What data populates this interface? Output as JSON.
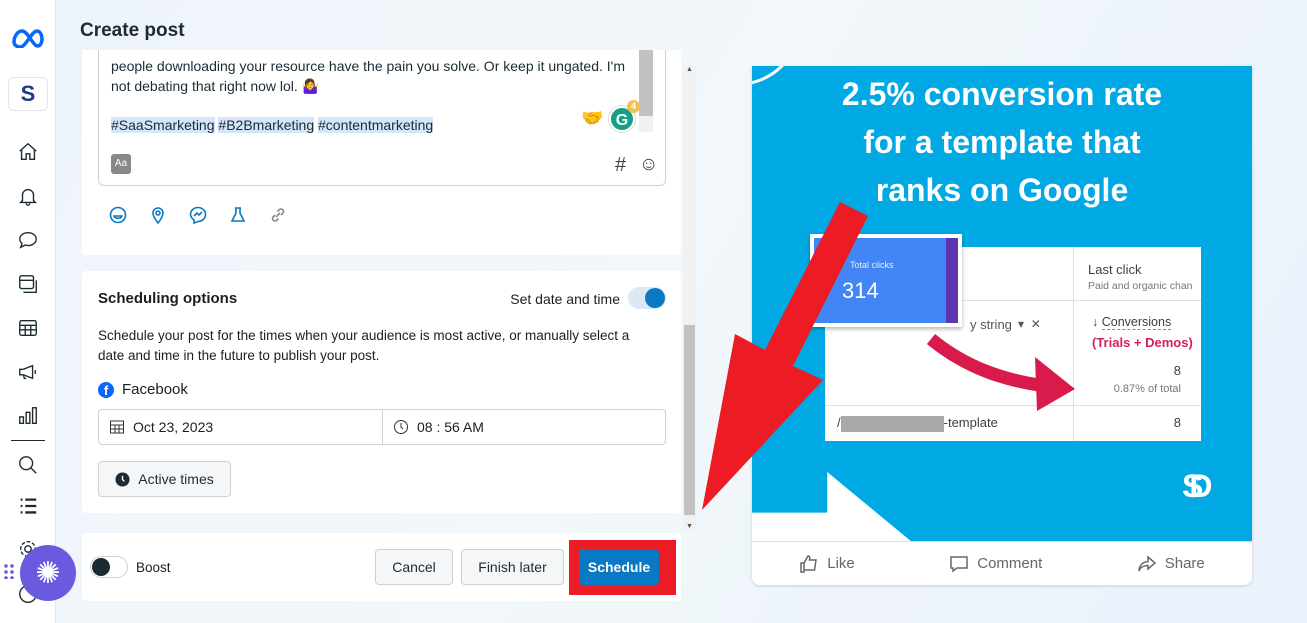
{
  "header": {
    "title": "Create post"
  },
  "sidebar": {
    "items": [
      {
        "name": "home",
        "icon": "home-icon"
      },
      {
        "name": "notifications",
        "icon": "bell-icon"
      },
      {
        "name": "inbox",
        "icon": "chat-icon"
      },
      {
        "name": "content",
        "icon": "content-icon"
      },
      {
        "name": "planner",
        "icon": "calendar-icon"
      },
      {
        "name": "ads",
        "icon": "megaphone-icon"
      },
      {
        "name": "insights",
        "icon": "bar-chart-icon"
      },
      {
        "name": "search",
        "icon": "search-icon"
      },
      {
        "name": "all-tools",
        "icon": "list-icon"
      },
      {
        "name": "settings",
        "icon": "gear-icon"
      },
      {
        "name": "help",
        "icon": "help-icon"
      }
    ],
    "account_initial": "S"
  },
  "editor": {
    "line1": "people downloading your resource have the pain you solve. Or keep it ungated. I'm",
    "line2": "not debating that right now lol. 🤷‍♀️",
    "hashtags": [
      "#SaaSmarketing",
      "#B2Bmarketing",
      "#contentmarketing"
    ],
    "grammarly_count": "4",
    "aa_label": "Aa",
    "hash_symbol": "#"
  },
  "scheduling": {
    "title": "Scheduling options",
    "toggle_label": "Set date and time",
    "toggle_on": true,
    "description": "Schedule your post for the times when your audience is most active, or manually select a date and time in the future to publish your post.",
    "platform": "Facebook",
    "date": "Oct 23, 2023",
    "time": "08 : 56 AM",
    "active_times_label": "Active times"
  },
  "footer": {
    "boost_label": "Boost",
    "boost_on": false,
    "cancel": "Cancel",
    "finish_later": "Finish later",
    "schedule": "Schedule"
  },
  "preview": {
    "headline": [
      "2.5% conversion rate",
      "for a template that",
      "ranks on Google"
    ],
    "card_label": "Total clicks",
    "card_value": "314",
    "last_click": "Last click",
    "last_click_sub": "Paid and organic chan",
    "filter_text": "y string",
    "conversions": "Conversions",
    "trials_demos": "(Trials + Demos)",
    "total_value": "8",
    "percent_total": "0.87% of total",
    "row_path": "/",
    "row_suffix": "-template",
    "row_value": "8",
    "logo": "SD",
    "actions": {
      "like": "Like",
      "comment": "Comment",
      "share": "Share"
    }
  },
  "colors": {
    "accent": "#0a78c2",
    "image_bg": "#00a9e3",
    "highlight_arrow": "#ed1c24",
    "meta_blue": "#0866ff",
    "fab": "#6a5ae0"
  }
}
